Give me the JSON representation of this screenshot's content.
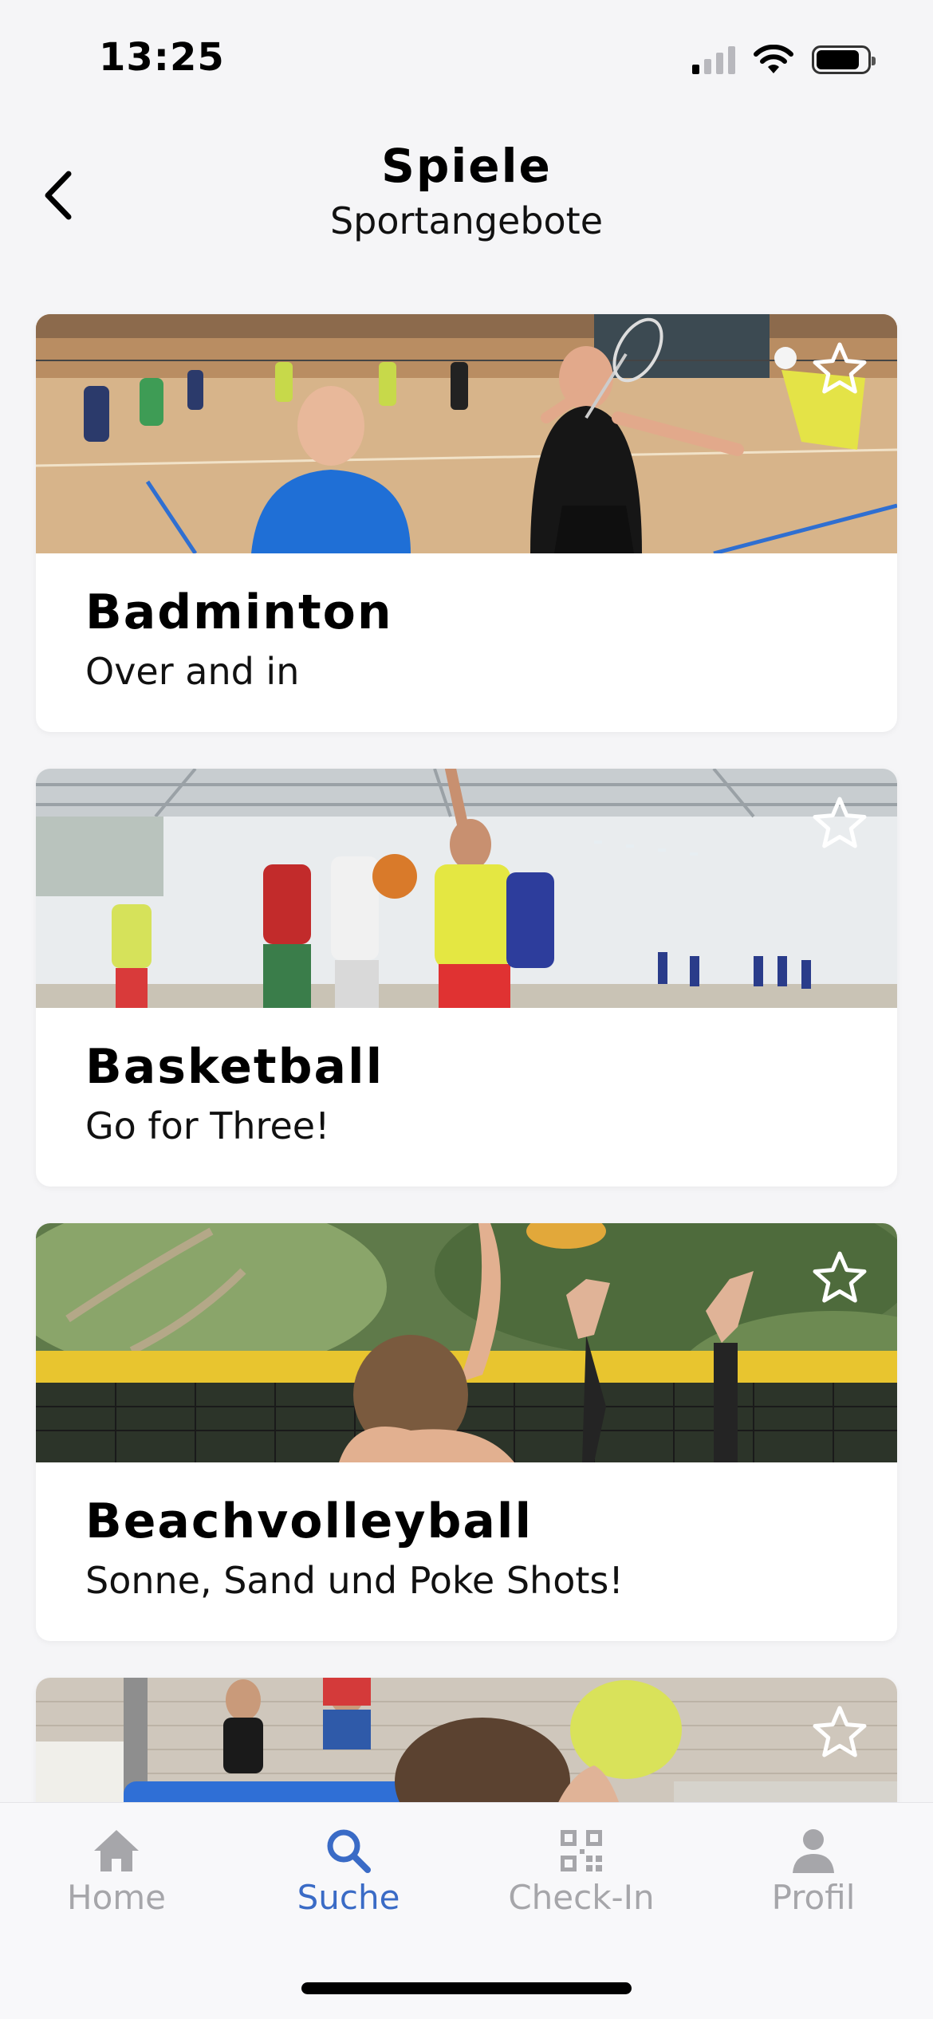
{
  "status_bar": {
    "time": "13:25"
  },
  "header": {
    "title": "Spiele",
    "subtitle": "Sportangebote",
    "back_icon": "chevron-left-icon"
  },
  "cards": [
    {
      "title": "Badminton",
      "subtitle": "Over and in",
      "favorite_icon": "star-outline-icon",
      "favorited": false
    },
    {
      "title": "Basketball",
      "subtitle": "Go for Three!",
      "favorite_icon": "star-outline-icon",
      "favorited": false
    },
    {
      "title": "Beachvolleyball",
      "subtitle": "Sonne, Sand und Poke Shots!",
      "favorite_icon": "star-outline-icon",
      "favorited": false
    },
    {
      "title": "",
      "subtitle": "",
      "favorite_icon": "star-outline-icon",
      "favorited": false
    }
  ],
  "tabs": [
    {
      "label": "Home",
      "icon": "home-icon",
      "active": false
    },
    {
      "label": "Suche",
      "icon": "search-icon",
      "active": true
    },
    {
      "label": "Check-In",
      "icon": "qr-code-icon",
      "active": false
    },
    {
      "label": "Profil",
      "icon": "person-icon",
      "active": false
    }
  ],
  "colors": {
    "accent": "#3a6bc6",
    "inactive": "#a6a6aa",
    "background": "#f5f5f7"
  }
}
